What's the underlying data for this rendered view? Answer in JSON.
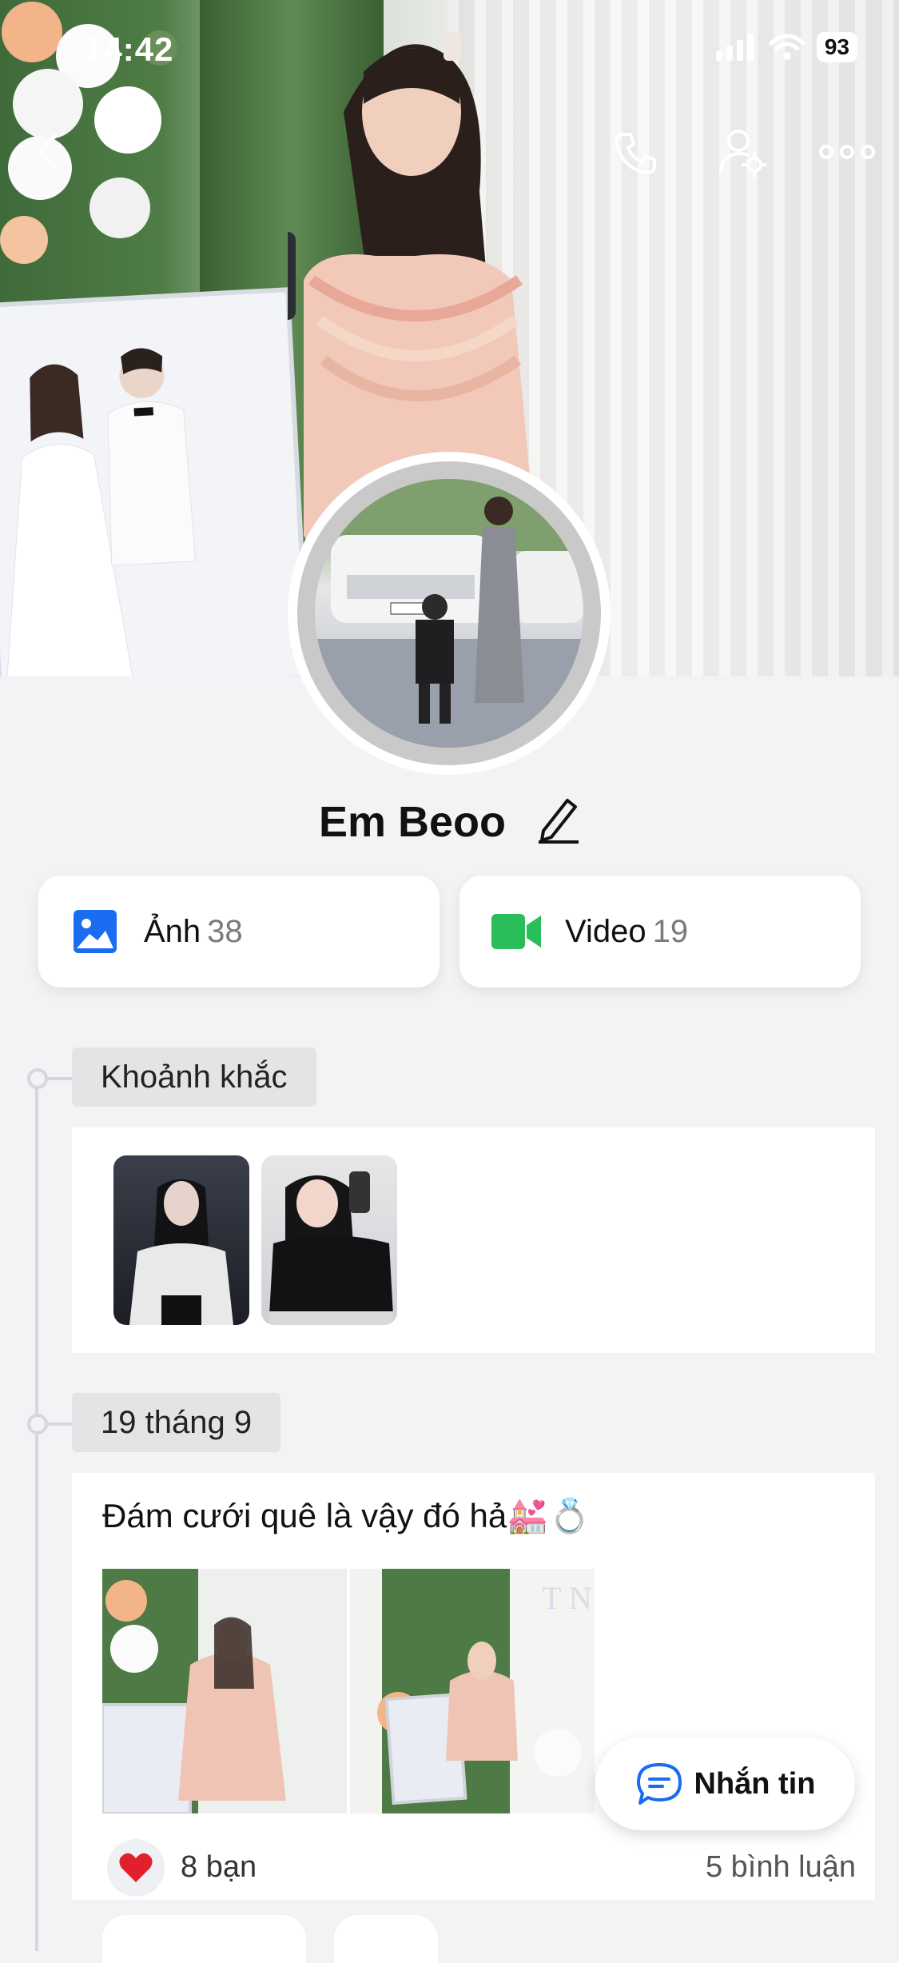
{
  "status_bar": {
    "time": "14:42",
    "battery": "93"
  },
  "header": {
    "back_icon": "chevron-left-icon",
    "call_icon": "phone-icon",
    "settings_icon": "user-gear-icon",
    "more_icon": "more-horizontal-icon"
  },
  "profile": {
    "name": "Em Beoo",
    "edit_icon": "pencil-icon"
  },
  "media_tabs": [
    {
      "label": "Ảnh",
      "count": "38",
      "icon": "image-icon",
      "color": "#1a6cf0"
    },
    {
      "label": "Video",
      "count": "19",
      "icon": "video-camera-icon",
      "color": "#2bbd5a"
    }
  ],
  "sections": {
    "moments_title": "Khoảnh khắc",
    "post_date": "19 tháng 9"
  },
  "post": {
    "text": "Đám cưới quê là vậy đó hả💒💍",
    "likes_label": "8 bạn",
    "comments_label": "5 bình luận"
  },
  "message_button": {
    "label": "Nhắn tin",
    "icon": "chat-bubble-icon"
  },
  "colors": {
    "accent": "#1a6cf0",
    "heart": "#e0202b"
  }
}
